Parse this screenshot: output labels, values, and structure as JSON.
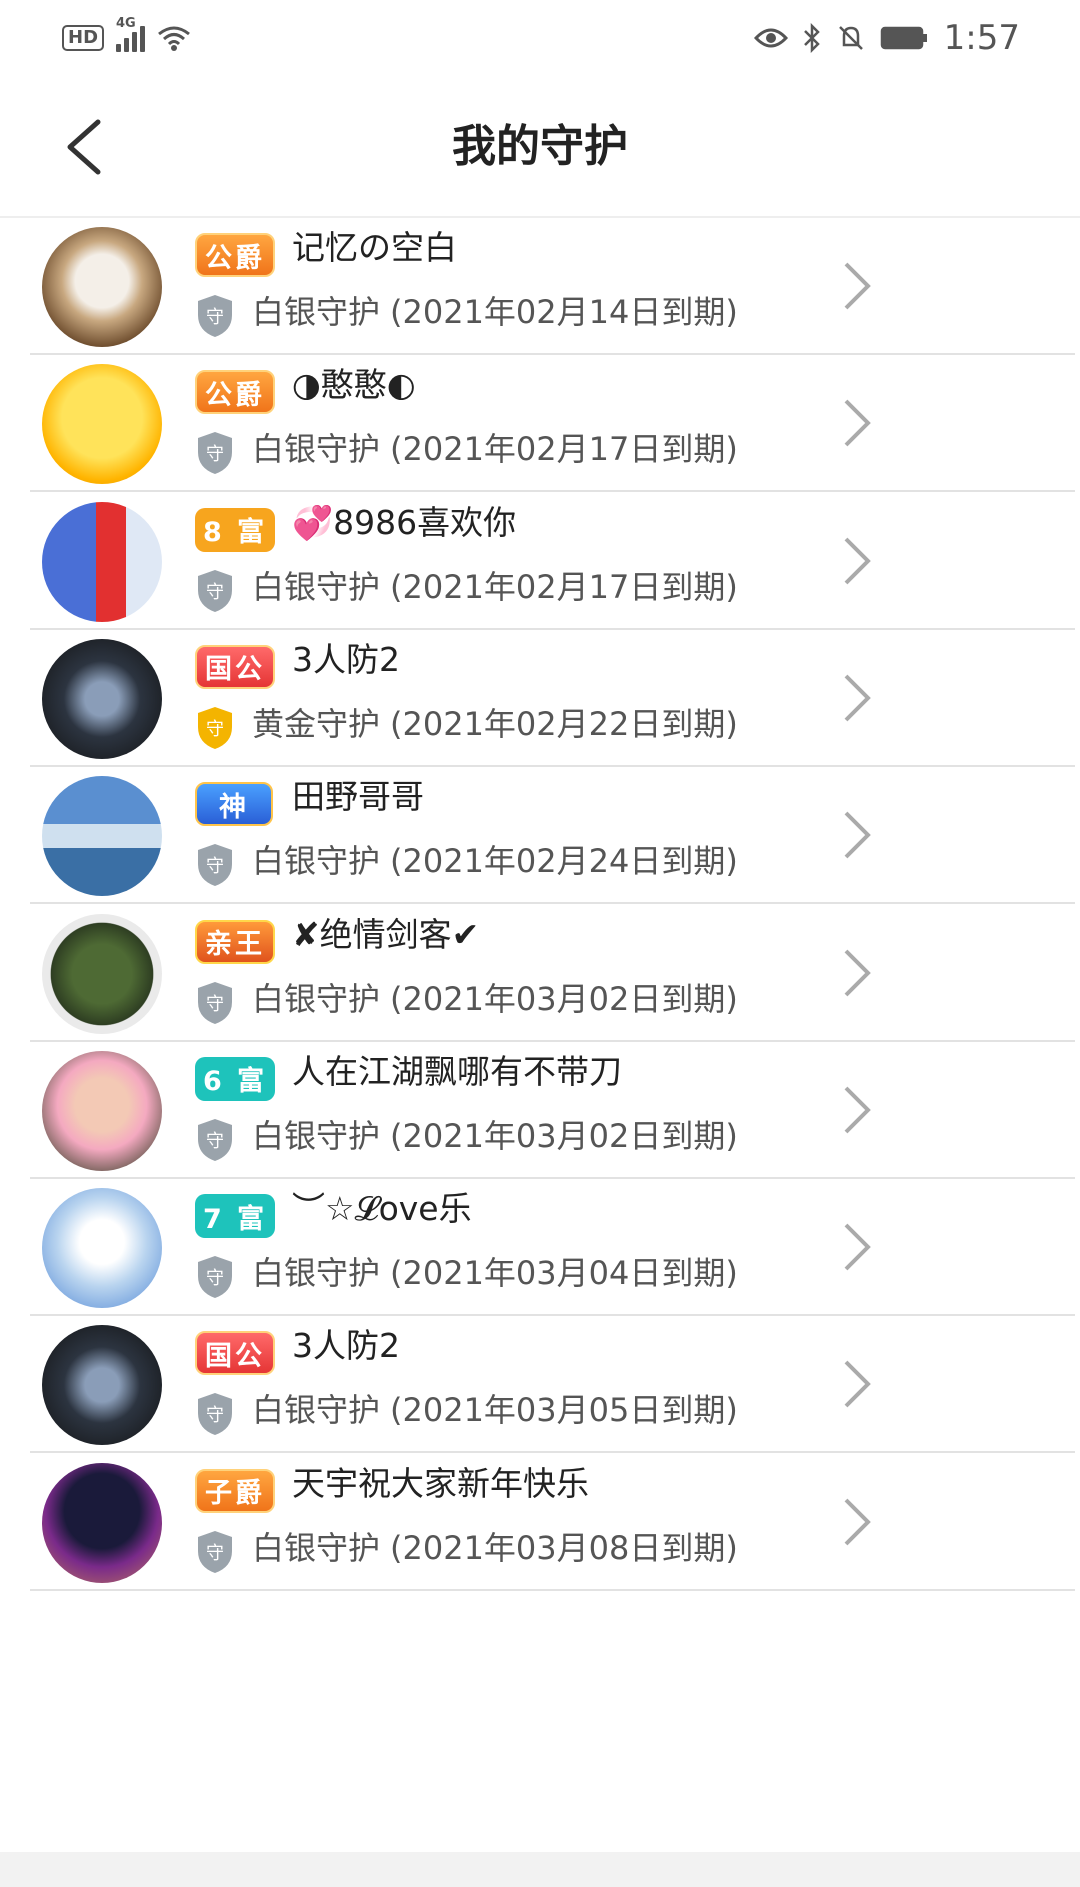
{
  "statusbar": {
    "network": "4G",
    "hd": "HD",
    "time": "1:57"
  },
  "header": {
    "title": "我的守护"
  },
  "colors": {
    "silver_shield": "#9aa3ab",
    "gold_shield": "#f4b400"
  },
  "rows": [
    {
      "badge": "公爵",
      "badge_style": "orange",
      "name": "记忆の空白",
      "level": "白银守护",
      "expiry": "(2021年02月14日到期)",
      "shield": "silver"
    },
    {
      "badge": "公爵",
      "badge_style": "orange",
      "name": "◑憨憨◐",
      "level": "白银守护",
      "expiry": "(2021年02月17日到期)",
      "shield": "silver"
    },
    {
      "badge": "8 富",
      "badge_style": "gold",
      "name": "💞8986喜欢你",
      "level": "白银守护",
      "expiry": "(2021年02月17日到期)",
      "shield": "silver"
    },
    {
      "badge": "国公",
      "badge_style": "red",
      "name": "3人防2",
      "level": "黄金守护",
      "expiry": "(2021年02月22日到期)",
      "shield": "gold"
    },
    {
      "badge": "神",
      "badge_style": "blue",
      "name": "田野哥哥",
      "level": "白银守护",
      "expiry": "(2021年02月24日到期)",
      "shield": "silver"
    },
    {
      "badge": "亲王",
      "badge_style": "prince",
      "name": "✘绝情剑客✔",
      "level": "白银守护",
      "expiry": "(2021年03月02日到期)",
      "shield": "silver"
    },
    {
      "badge": "6 富",
      "badge_style": "teal",
      "name": "人在江湖飘哪有不带刀",
      "level": "白银守护",
      "expiry": "(2021年03月02日到期)",
      "shield": "silver"
    },
    {
      "badge": "7 富",
      "badge_style": "teal",
      "name": "︶☆𝓛ove乐",
      "level": "白银守护",
      "expiry": "(2021年03月04日到期)",
      "shield": "silver"
    },
    {
      "badge": "国公",
      "badge_style": "red",
      "name": "3人防2",
      "level": "白银守护",
      "expiry": "(2021年03月05日到期)",
      "shield": "silver"
    },
    {
      "badge": "子爵",
      "badge_style": "orange",
      "name": "天宇祝大家新年快乐",
      "level": "白银守护",
      "expiry": "(2021年03月08日到期)",
      "shield": "silver"
    }
  ]
}
